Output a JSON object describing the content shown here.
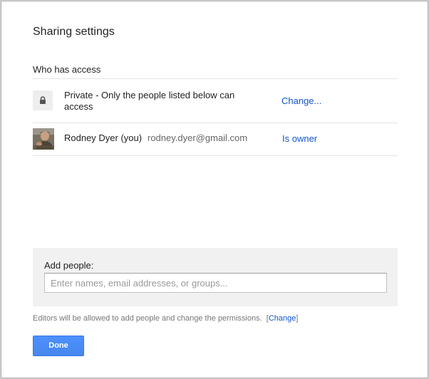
{
  "dialog": {
    "title": "Sharing settings",
    "section_label": "Who has access"
  },
  "access": {
    "icon": "lock-icon",
    "text": "Private - Only the people listed below can access",
    "change_link": "Change..."
  },
  "owner": {
    "avatar_icon": "user-photo",
    "name": "Rodney Dyer (you)",
    "email": "rodney.dyer@gmail.com",
    "role": "Is owner"
  },
  "add_people": {
    "label": "Add people:",
    "placeholder": "Enter names, email addresses, or groups...",
    "value": ""
  },
  "note": {
    "text": "Editors will be allowed to add people and change the permissions.",
    "bracket_open": "[",
    "change_link": "Change",
    "bracket_close": "]"
  },
  "done_label": "Done",
  "colors": {
    "link": "#1155cc",
    "primary_button": "#4d90fe",
    "panel_background": "#f1f1f1"
  }
}
